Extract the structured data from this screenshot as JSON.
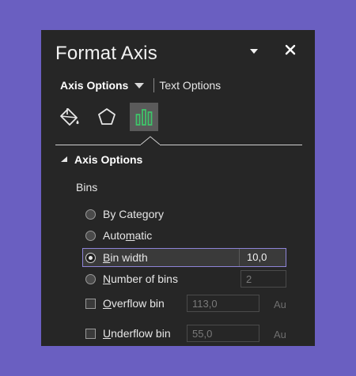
{
  "panel": {
    "title": "Format Axis",
    "tabs": {
      "active": "Axis Options",
      "inactive": "Text Options"
    },
    "icon_tabs": [
      "paint-bucket-icon",
      "pentagon-icon",
      "bar-chart-icon"
    ],
    "section": "Axis Options",
    "bins_label": "Bins",
    "options": {
      "by_category": "By Category",
      "automatic": {
        "pre": "Auto",
        "ul": "m",
        "post": "atic"
      },
      "bin_width": {
        "pre": "",
        "ul": "B",
        "post": "in width",
        "value": "10,0"
      },
      "number_of_bins": {
        "pre": "",
        "ul": "N",
        "post": "umber of bins",
        "value": "2"
      },
      "overflow_bin": {
        "pre": "",
        "ul": "O",
        "post": "verflow bin",
        "value": "113,0",
        "auto": "Au"
      },
      "underflow_bin": {
        "pre": "",
        "ul": "U",
        "post": "nderflow bin",
        "value": "55,0",
        "auto": "Au"
      }
    },
    "selected_option": "bin_width",
    "colors": {
      "panel_bg": "#262626",
      "page_bg": "#6a5fc1",
      "highlight": "#8e84d8",
      "selected_icon_bg": "#5a5a5a",
      "chart_icon": "#3fc46a"
    }
  }
}
